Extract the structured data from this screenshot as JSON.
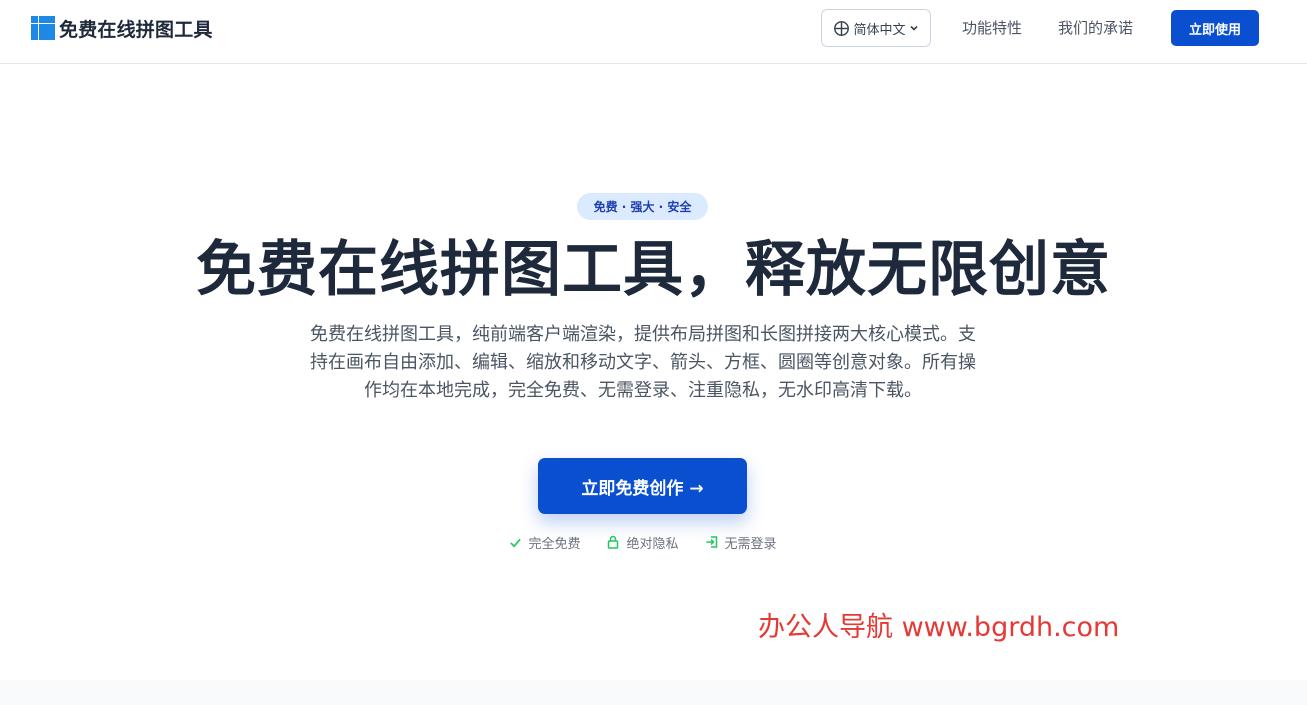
{
  "header": {
    "brand_name": "免费在线拼图工具",
    "language": "简体中文",
    "nav": {
      "features": "功能特性",
      "promise": "我们的承诺"
    },
    "cta_label": "立即使用"
  },
  "hero": {
    "badge": "免费 · 强大 · 安全",
    "title": "免费在线拼图工具，释放无限创意",
    "description": "免费在线拼图工具，纯前端客户端渲染，提供布局拼图和长图拼接两大核心模式。支持在画布自由添加、编辑、缩放和移动文字、箭头、方框、圆圈等创意对象。所有操作均在本地完成，完全免费、无需登录、注重隐私，无水印高清下载。",
    "cta_label": "立即免费创作 →",
    "features": [
      {
        "icon": "check-icon",
        "label": "完全免费"
      },
      {
        "icon": "lock-icon",
        "label": "绝对隐私"
      },
      {
        "icon": "login-icon",
        "label": "无需登录"
      }
    ]
  },
  "watermark": "办公人导航 www.bgrdh.com",
  "colors": {
    "primary": "#0a4fd0",
    "badge_bg": "#dbeafe",
    "badge_text": "#1e40af",
    "feature_icon": "#22c55e",
    "watermark": "#e53935"
  }
}
